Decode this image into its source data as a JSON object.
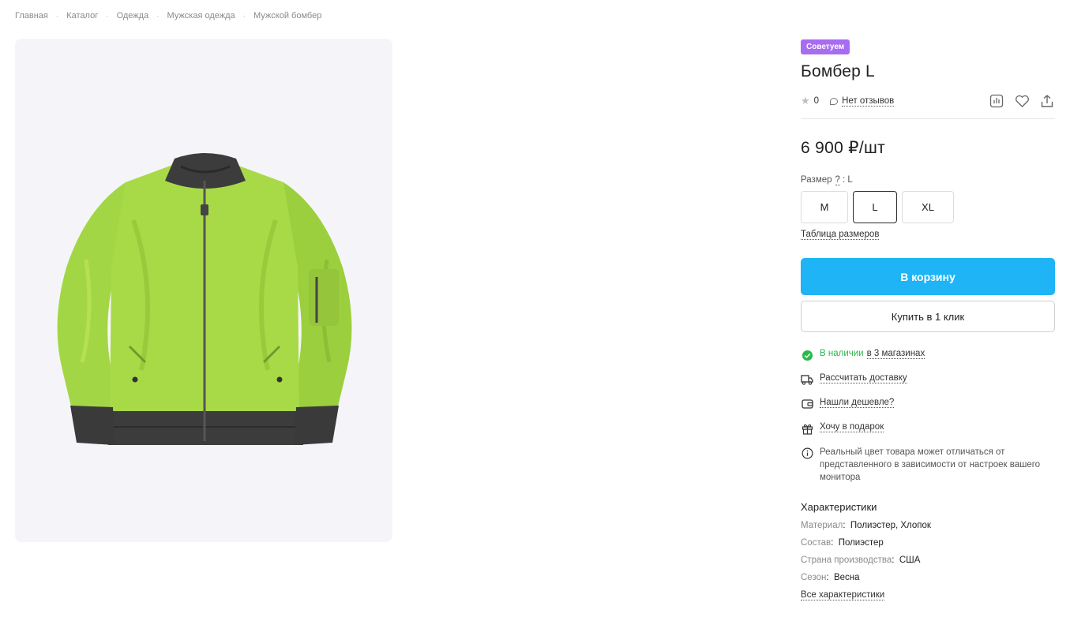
{
  "breadcrumb": {
    "items": [
      "Главная",
      "Каталог",
      "Одежда",
      "Мужская одежда",
      "Мужской бомбер"
    ],
    "separator": "·"
  },
  "product": {
    "badge": "Советуем",
    "title": "Бомбер L",
    "rating": "0",
    "reviews": "Нет отзывов",
    "price": "6 900 ₽/шт",
    "size_label": "Размер",
    "size_help": "?",
    "size_selected": ": L",
    "sizes": [
      "M",
      "L",
      "XL"
    ],
    "size_table": "Таблица размеров",
    "cart_button": "В корзину",
    "one_click_button": "Купить в 1 клик"
  },
  "features": {
    "in_stock": "В наличии",
    "stores": "в 3 магазинах",
    "delivery": "Рассчитать доставку",
    "cheaper": "Нашли дешевле?",
    "gift": "Хочу в подарок",
    "color_note": "Реальный цвет товара может отличаться от представленного в зависимости от настроек вашего монитора"
  },
  "characteristics": {
    "title": "Характеристики",
    "rows": [
      {
        "key": "Материал",
        "value": "Полиэстер, Хлопок"
      },
      {
        "key": "Состав",
        "value": "Полиэстер"
      },
      {
        "key": "Страна производства",
        "value": "США"
      },
      {
        "key": "Сезон",
        "value": "Весна"
      }
    ],
    "all_link": "Все характеристики"
  },
  "colors": {
    "accent": "#1eb4f5",
    "badge": "#a76cf2",
    "in_stock": "#2bb84a",
    "jacket": "#a3d645",
    "rib": "#3c3c3c"
  },
  "icons": [
    "star-icon",
    "comment-icon",
    "compare-icon",
    "heart-icon",
    "share-icon",
    "check-circle-icon",
    "truck-icon",
    "wallet-icon",
    "gift-icon",
    "info-icon"
  ]
}
